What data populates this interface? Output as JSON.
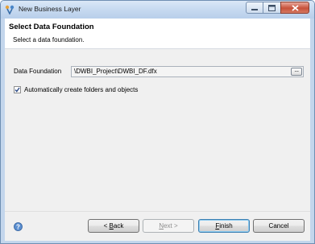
{
  "window": {
    "title": "New Business Layer",
    "controls": {
      "minimize": "minimize",
      "maximize": "maximize",
      "close": "close"
    }
  },
  "header": {
    "title": "Select Data Foundation",
    "subtitle": "Select a data foundation."
  },
  "form": {
    "data_foundation_label": "Data Foundation",
    "data_foundation_value": "\\DWBI_Project\\DWBI_DF.dfx",
    "browse_label": "...",
    "auto_create_label": "Automatically create folders and objects",
    "auto_create_checked": true
  },
  "buttons": {
    "back_prefix": "< ",
    "back_accel": "B",
    "back_rest": "ack",
    "next_accel": "N",
    "next_rest": "ext >",
    "finish_accel": "F",
    "finish_rest": "inish",
    "cancel": "Cancel"
  },
  "icons": {
    "app": "business-layer-icon",
    "help": "help-icon",
    "check": "checkmark-icon"
  }
}
